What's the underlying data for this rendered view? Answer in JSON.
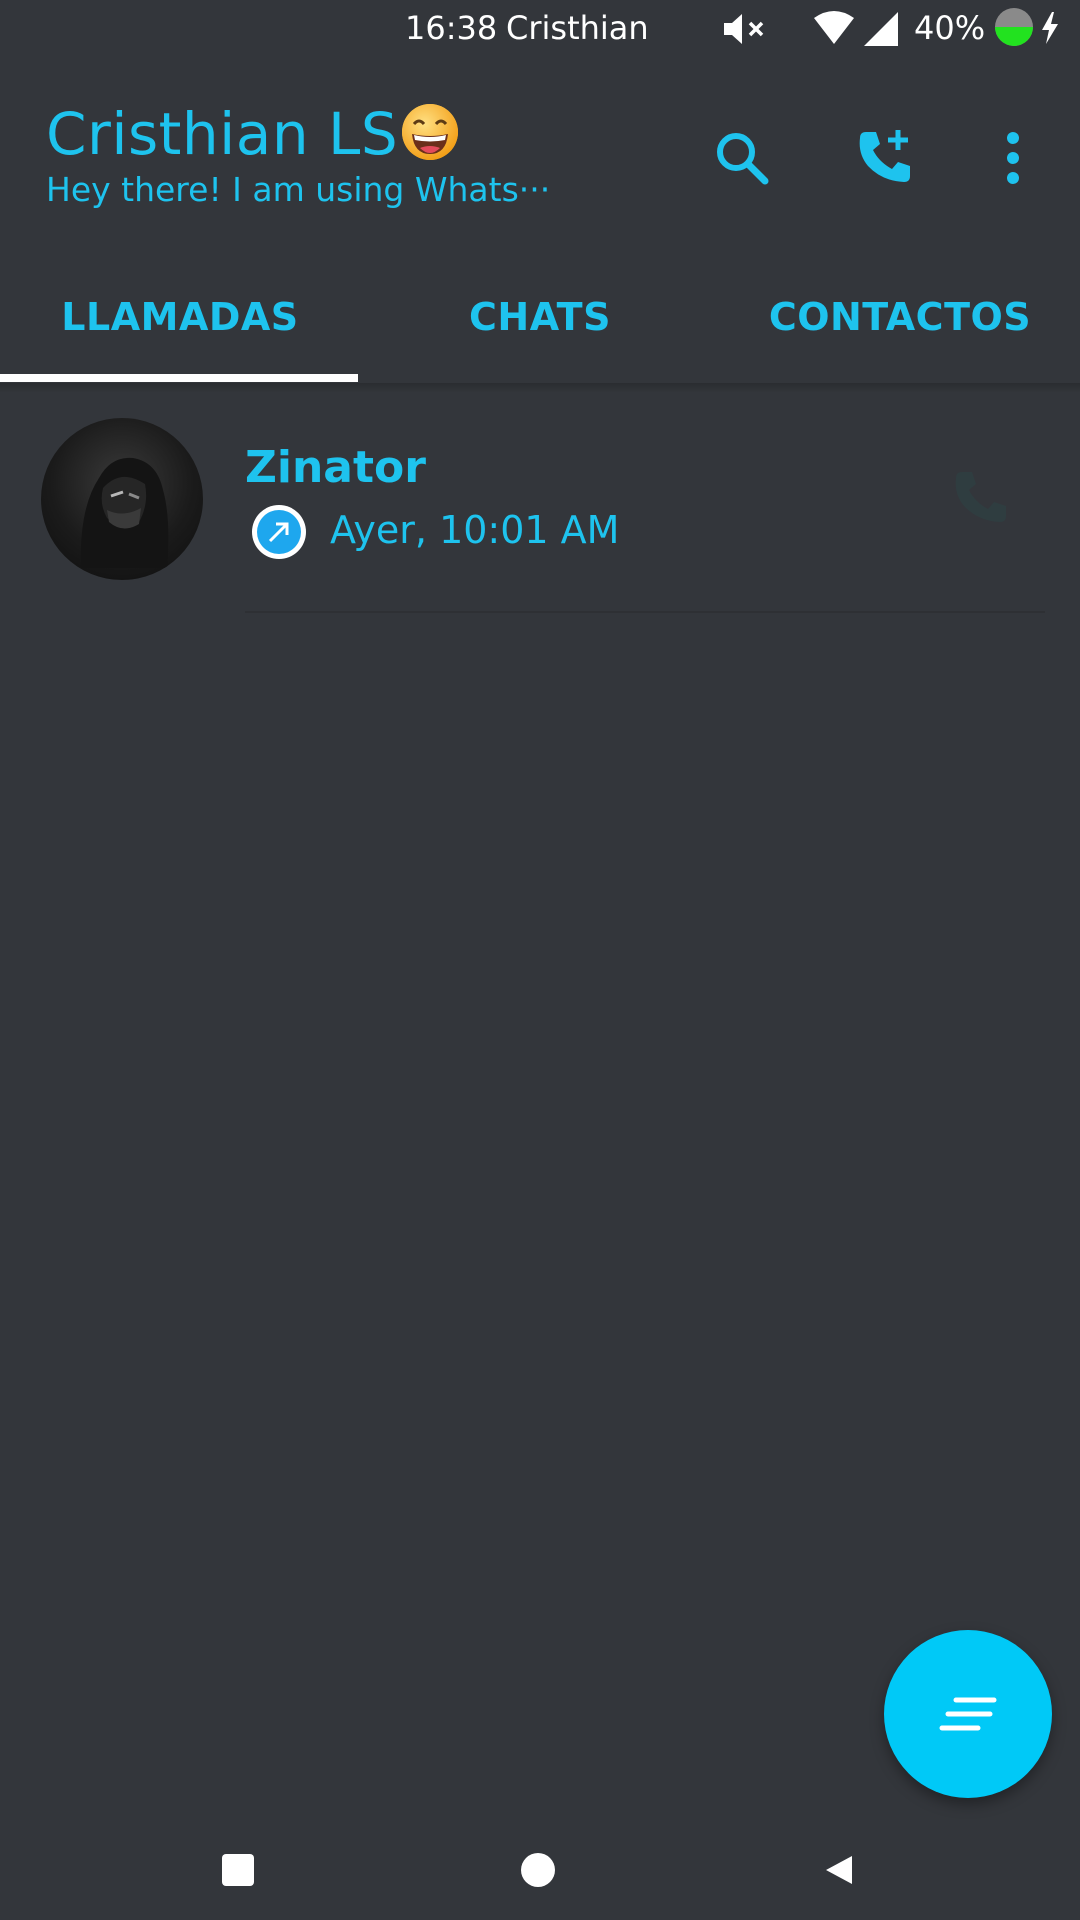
{
  "status_bar": {
    "time": "16:38",
    "carrier": "Cristhian",
    "battery_percent": "40%",
    "icons": [
      "mute-icon",
      "wifi-icon",
      "signal-icon",
      "battery-icon",
      "charging-icon"
    ]
  },
  "header": {
    "title": "Cristhian LS",
    "title_emoji": "grinning-face-emoji",
    "subtitle": "Hey there! I am using Whats···",
    "actions": [
      "search-icon",
      "add-call-icon",
      "more-options-icon"
    ]
  },
  "tabs": [
    {
      "label": "LLAMADAS",
      "selected": true
    },
    {
      "label": "CHATS",
      "selected": false
    },
    {
      "label": "CONTACTOS",
      "selected": false
    }
  ],
  "calls": [
    {
      "name": "Zinator",
      "direction": "outgoing",
      "time": "Ayer, 10:01 AM",
      "action_icon": "phone-icon"
    }
  ],
  "fab": {
    "icon": "new-call-list-icon"
  },
  "colors": {
    "accent": "#1ec3ee",
    "background": "#33363b",
    "fab": "#00c9f7",
    "indicator": "#ffffff"
  },
  "navigation": [
    "recent-apps-icon",
    "home-icon",
    "back-icon"
  ]
}
